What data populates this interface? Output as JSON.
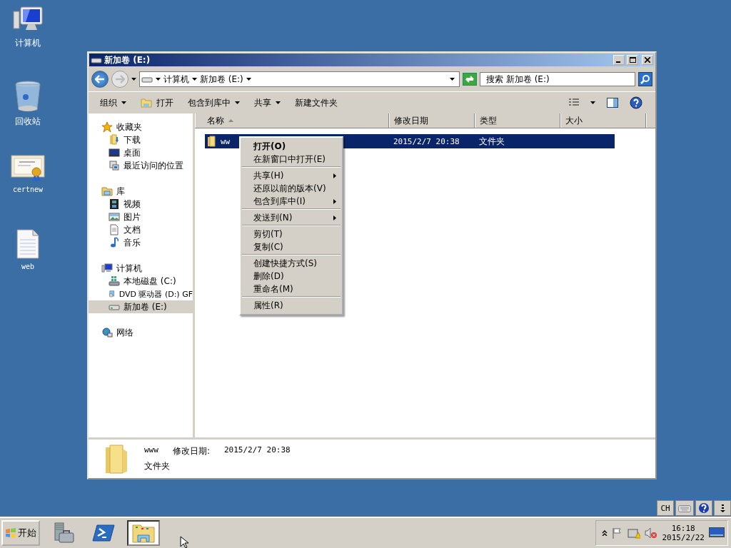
{
  "desktop_icons": [
    {
      "label": "计算机",
      "kind": "computer"
    },
    {
      "label": "回收站",
      "kind": "recycle"
    },
    {
      "label": "certnew",
      "kind": "certificate"
    },
    {
      "label": "web",
      "kind": "document"
    }
  ],
  "window": {
    "title": "新加卷 (E:)",
    "address": {
      "segments": [
        "计算机",
        "新加卷 (E:)"
      ]
    },
    "search": {
      "placeholder": "搜索 新加卷 (E:)"
    },
    "toolbar": [
      {
        "label": "组织",
        "kind": "menu",
        "dropdown": true
      },
      {
        "label": "打开",
        "kind": "open",
        "dropdown": false
      },
      {
        "label": "包含到库中",
        "kind": "menu",
        "dropdown": true
      },
      {
        "label": "共享",
        "kind": "menu",
        "dropdown": true
      },
      {
        "label": "新建文件夹",
        "kind": "menu",
        "dropdown": false
      }
    ],
    "nav": [
      {
        "label": "收藏夹",
        "kind": "star",
        "selected": false,
        "children": [
          {
            "label": "下载",
            "kind": "download",
            "selected": false
          },
          {
            "label": "桌面",
            "kind": "desktop",
            "selected": false
          },
          {
            "label": "最近访问的位置",
            "kind": "recent",
            "selected": false
          }
        ]
      },
      {
        "label": "库",
        "kind": "library",
        "selected": false,
        "children": [
          {
            "label": "视频",
            "kind": "video",
            "selected": false
          },
          {
            "label": "图片",
            "kind": "picture",
            "selected": false
          },
          {
            "label": "文档",
            "kind": "doc",
            "selected": false
          },
          {
            "label": "音乐",
            "kind": "music",
            "selected": false
          }
        ]
      },
      {
        "label": "计算机",
        "kind": "computer",
        "selected": false,
        "children": [
          {
            "label": "本地磁盘 (C:)",
            "kind": "system-drive",
            "selected": false
          },
          {
            "label": "DVD 驱动器 (D:) GF",
            "kind": "dvd",
            "selected": false
          },
          {
            "label": "新加卷 (E:)",
            "kind": "drive",
            "selected": true
          }
        ]
      },
      {
        "label": "网络",
        "kind": "network",
        "selected": false
      }
    ],
    "columns": [
      {
        "label": "名称",
        "sorted": true
      },
      {
        "label": "修改日期",
        "sorted": false
      },
      {
        "label": "类型",
        "sorted": false
      },
      {
        "label": "大小",
        "sorted": false
      }
    ],
    "rows": [
      {
        "name": "ww",
        "modified": "2015/2/7 20:38",
        "type": "文件夹",
        "selected": true
      }
    ],
    "details": {
      "name": "www",
      "modified_label": "修改日期:",
      "modified": "2015/2/7 20:38",
      "type": "文件夹"
    }
  },
  "context_menu": {
    "groups": [
      [
        {
          "label": "打开(O)",
          "default": true,
          "submenu": false
        },
        {
          "label": "在新窗口中打开(E)",
          "default": false,
          "submenu": false
        }
      ],
      [
        {
          "label": "共享(H)",
          "default": false,
          "submenu": true
        },
        {
          "label": "还原以前的版本(V)",
          "default": false,
          "submenu": false
        },
        {
          "label": "包含到库中(I)",
          "default": false,
          "submenu": true
        }
      ],
      [
        {
          "label": "发送到(N)",
          "default": false,
          "submenu": true
        }
      ],
      [
        {
          "label": "剪切(T)",
          "default": false,
          "submenu": false
        },
        {
          "label": "复制(C)",
          "default": false,
          "submenu": false
        }
      ],
      [
        {
          "label": "创建快捷方式(S)",
          "default": false,
          "submenu": false
        },
        {
          "label": "删除(D)",
          "default": false,
          "submenu": false
        },
        {
          "label": "重命名(M)",
          "default": false,
          "submenu": false
        }
      ],
      [
        {
          "label": "属性(R)",
          "default": false,
          "submenu": false
        }
      ]
    ]
  },
  "language_bar": {
    "language": "CH"
  },
  "taskbar": {
    "start": "开始",
    "apps": [
      {
        "kind": "server-manager",
        "active": false
      },
      {
        "kind": "powershell",
        "active": false
      },
      {
        "kind": "explorer",
        "active": true
      }
    ],
    "clock": {
      "time": "16:18",
      "date": "2015/2/22"
    }
  }
}
